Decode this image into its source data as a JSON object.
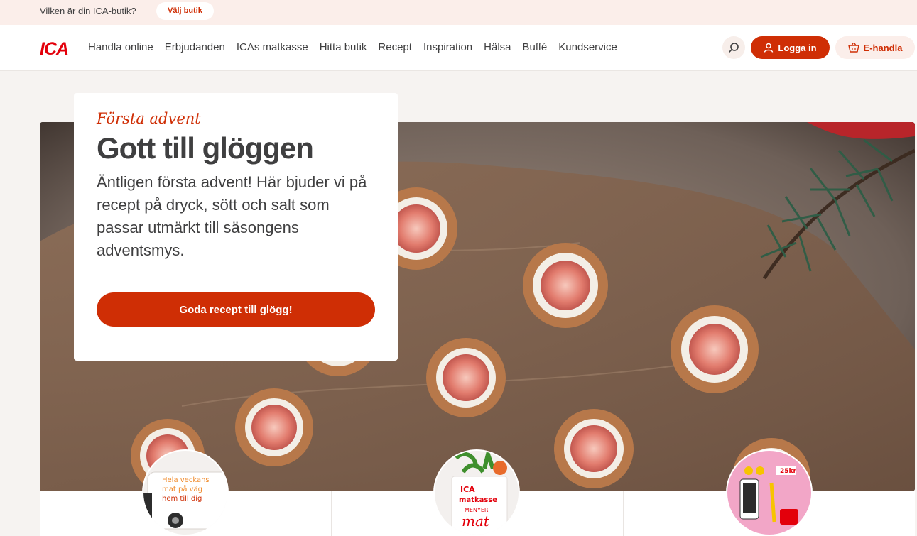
{
  "topbar": {
    "question": "Vilken är din ICA-butik?",
    "choose_store": "Välj butik"
  },
  "nav": {
    "logo": "ICA",
    "menu": [
      "Handla online",
      "Erbjudanden",
      "ICAs matkasse",
      "Hitta butik",
      "Recept",
      "Inspiration",
      "Hälsa",
      "Buffé",
      "Kundservice"
    ],
    "login_label": "Logga in",
    "ehandla_label": "E-handla"
  },
  "hero": {
    "kicker": "Första advent",
    "title": "Gott till glöggen",
    "body": "Äntligen första advent! Här bjuder vi på recept på dryck, sött och salt som passar utmärkt till säsongens adventsmys.",
    "cta": "Goda recept till glögg!"
  },
  "tiles": {
    "van_text": "Hela veckans mat på väg hem till dig",
    "bag_brand": "ICA matkasse",
    "bag_menu": "MENYER",
    "bag_word": "mat",
    "price_tag": "25kr"
  },
  "colors": {
    "accent": "#cf2e05",
    "logo_red": "#e3000b",
    "topbar_bg": "#fbeeea",
    "page_bg": "#f6f3f1"
  },
  "icons": [
    "search-icon",
    "user-icon",
    "basket-icon"
  ]
}
